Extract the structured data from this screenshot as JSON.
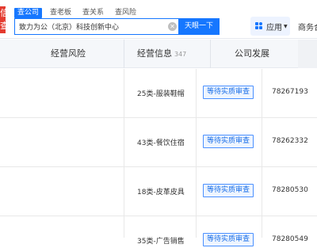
{
  "logo": {
    "chars": [
      "信",
      "查"
    ],
    "color": "#e43b2f"
  },
  "search": {
    "tabs": [
      {
        "label": "查公司",
        "active": true
      },
      {
        "label": "查老板",
        "active": false
      },
      {
        "label": "查关系",
        "active": false
      },
      {
        "label": "查风险",
        "active": false
      }
    ],
    "value": "致力为公（北京）科技创新中心",
    "button_label": "天眼一下",
    "clear_icon": "close-circle-icon"
  },
  "header_right": {
    "apps_label": "应用",
    "apps_icon": "grid-apps-icon",
    "business_label": "商务合作"
  },
  "section_tabs": [
    {
      "label": "经营风险",
      "count": ""
    },
    {
      "label": "经营信息",
      "count": "347"
    },
    {
      "label": "公司发展",
      "count": ""
    }
  ],
  "rows": [
    {
      "category": "25类-服装鞋帽",
      "status": "等待实质审查",
      "reg_no": "78267193"
    },
    {
      "category": "43类-餐饮住宿",
      "status": "等待实质审查",
      "reg_no": "78262332"
    },
    {
      "category": "18类-皮革皮具",
      "status": "等待实质审查",
      "reg_no": "78280530"
    },
    {
      "category": "35类-广告销售",
      "status": "等待实质审查",
      "reg_no": "78280549"
    }
  ],
  "colors": {
    "accent": "#1677ff",
    "status_border": "#4a90ff",
    "status_text": "#1a6fe8"
  }
}
